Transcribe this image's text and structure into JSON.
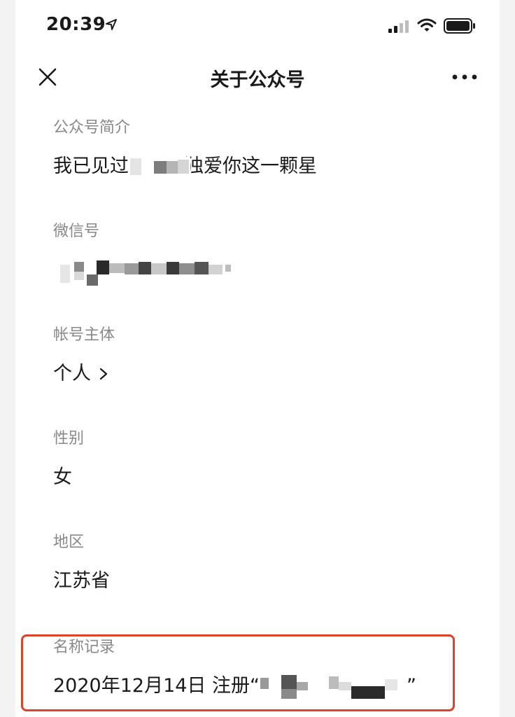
{
  "status_bar": {
    "time": "20:39",
    "icons": [
      "location-arrow-icon",
      "cellular-signal-icon",
      "wifi-icon",
      "battery-icon"
    ]
  },
  "nav": {
    "title": "关于公众号",
    "close_icon": "close-icon",
    "more_icon": "more-icon"
  },
  "sections": {
    "intro": {
      "label": "公众号简介",
      "value_prefix": "我已见过",
      "value_suffix": "独爱你这一颗星"
    },
    "wechat_id": {
      "label": "微信号"
    },
    "account_subject": {
      "label": "帐号主体",
      "value": "个人"
    },
    "gender": {
      "label": "性别",
      "value": "女"
    },
    "region": {
      "label": "地区",
      "value": "江苏省"
    },
    "name_history": {
      "label": "名称记录",
      "value_prefix": "2020年12月14日 注册“",
      "value_suffix": "”"
    }
  },
  "colors": {
    "highlight_border": "#d9442b",
    "label_gray": "#888888",
    "text_dark": "#1a1a1a"
  }
}
